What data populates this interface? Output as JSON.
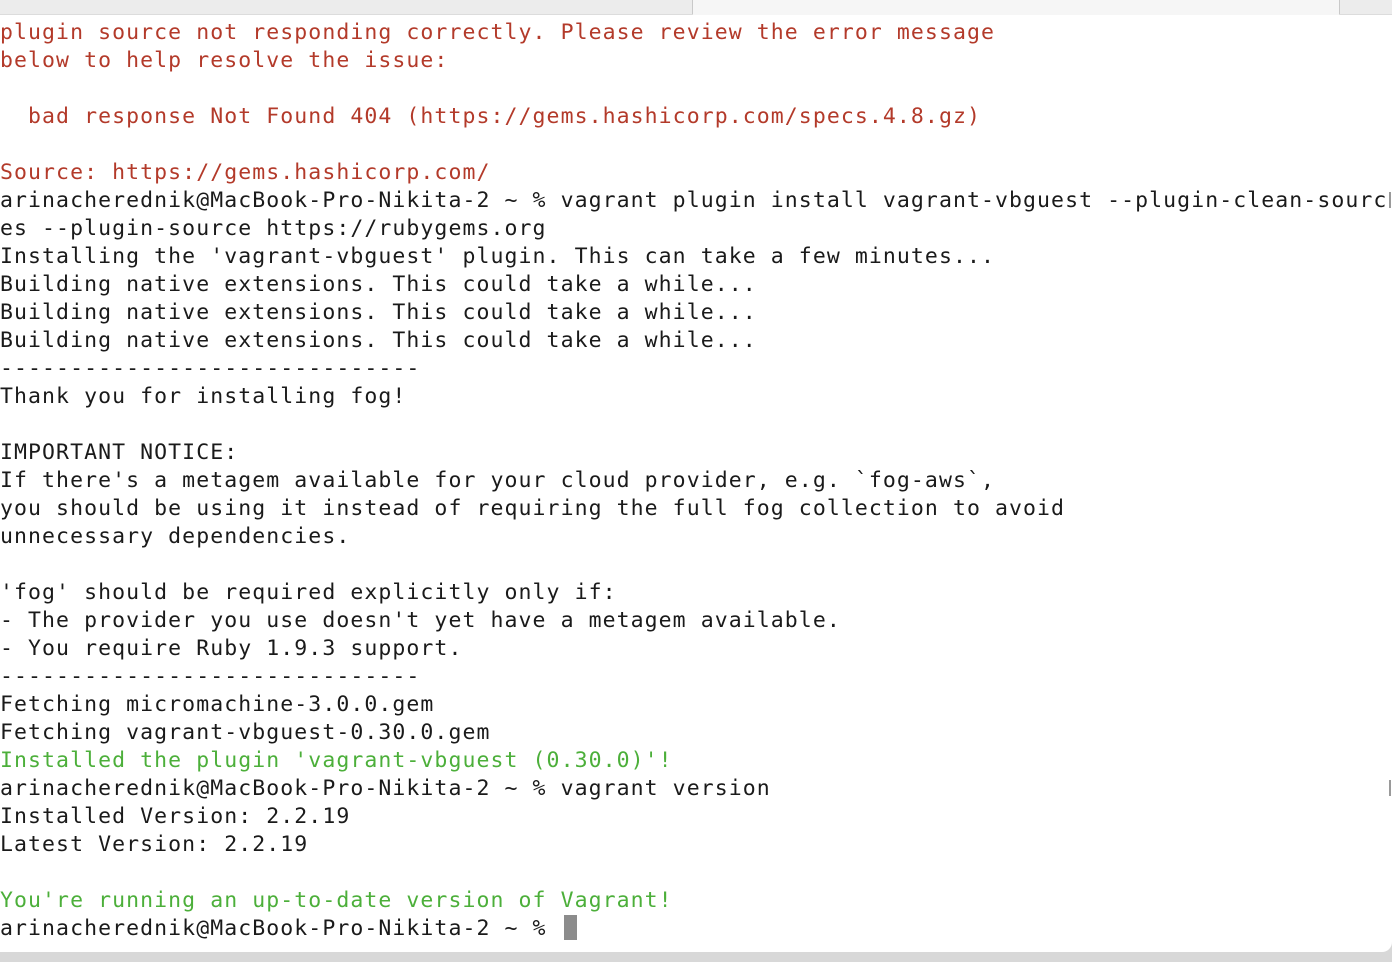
{
  "terminal": {
    "lines": [
      {
        "text": "plugin source not responding correctly. Please review the error message",
        "style": "err"
      },
      {
        "text": "below to help resolve the issue:",
        "style": "err"
      },
      {
        "text": "",
        "style": "normal"
      },
      {
        "text": "  bad response Not Found 404 (https://gems.hashicorp.com/specs.4.8.gz)",
        "style": "err"
      },
      {
        "text": "",
        "style": "normal"
      },
      {
        "text": "Source: https://gems.hashicorp.com/",
        "style": "err"
      },
      {
        "text": "arinacherednik@MacBook-Pro-Nikita-2 ~ % vagrant plugin install vagrant-vbguest --plugin-clean-sourc",
        "style": "normal"
      },
      {
        "text": "es --plugin-source https://rubygems.org",
        "style": "normal"
      },
      {
        "text": "Installing the 'vagrant-vbguest' plugin. This can take a few minutes...",
        "style": "normal"
      },
      {
        "text": "Building native extensions. This could take a while...",
        "style": "normal"
      },
      {
        "text": "Building native extensions. This could take a while...",
        "style": "normal"
      },
      {
        "text": "Building native extensions. This could take a while...",
        "style": "normal"
      },
      {
        "text": "------------------------------",
        "style": "normal"
      },
      {
        "text": "Thank you for installing fog!",
        "style": "normal"
      },
      {
        "text": "",
        "style": "normal"
      },
      {
        "text": "IMPORTANT NOTICE:",
        "style": "normal"
      },
      {
        "text": "If there's a metagem available for your cloud provider, e.g. `fog-aws`,",
        "style": "normal"
      },
      {
        "text": "you should be using it instead of requiring the full fog collection to avoid",
        "style": "normal"
      },
      {
        "text": "unnecessary dependencies.",
        "style": "normal"
      },
      {
        "text": "",
        "style": "normal"
      },
      {
        "text": "'fog' should be required explicitly only if:",
        "style": "normal"
      },
      {
        "text": "- The provider you use doesn't yet have a metagem available.",
        "style": "normal"
      },
      {
        "text": "- You require Ruby 1.9.3 support.",
        "style": "normal"
      },
      {
        "text": "------------------------------",
        "style": "normal"
      },
      {
        "text": "Fetching micromachine-3.0.0.gem",
        "style": "normal"
      },
      {
        "text": "Fetching vagrant-vbguest-0.30.0.gem",
        "style": "normal"
      },
      {
        "text": "Installed the plugin 'vagrant-vbguest (0.30.0)'!",
        "style": "ok"
      },
      {
        "text": "arinacherednik@MacBook-Pro-Nikita-2 ~ % vagrant version",
        "style": "normal"
      },
      {
        "text": "Installed Version: 2.2.19",
        "style": "normal"
      },
      {
        "text": "Latest Version: 2.2.19",
        "style": "normal"
      },
      {
        "text": "",
        "style": "normal"
      },
      {
        "text": "You're running an up-to-date version of Vagrant!",
        "style": "ok"
      }
    ],
    "prompt": "arinacherednik@MacBook-Pro-Nikita-2 ~ % "
  },
  "colors": {
    "error": "#b33a2a",
    "success": "#4caf3a",
    "text": "#1a1a1a",
    "cursor": "#8c8c8c"
  }
}
